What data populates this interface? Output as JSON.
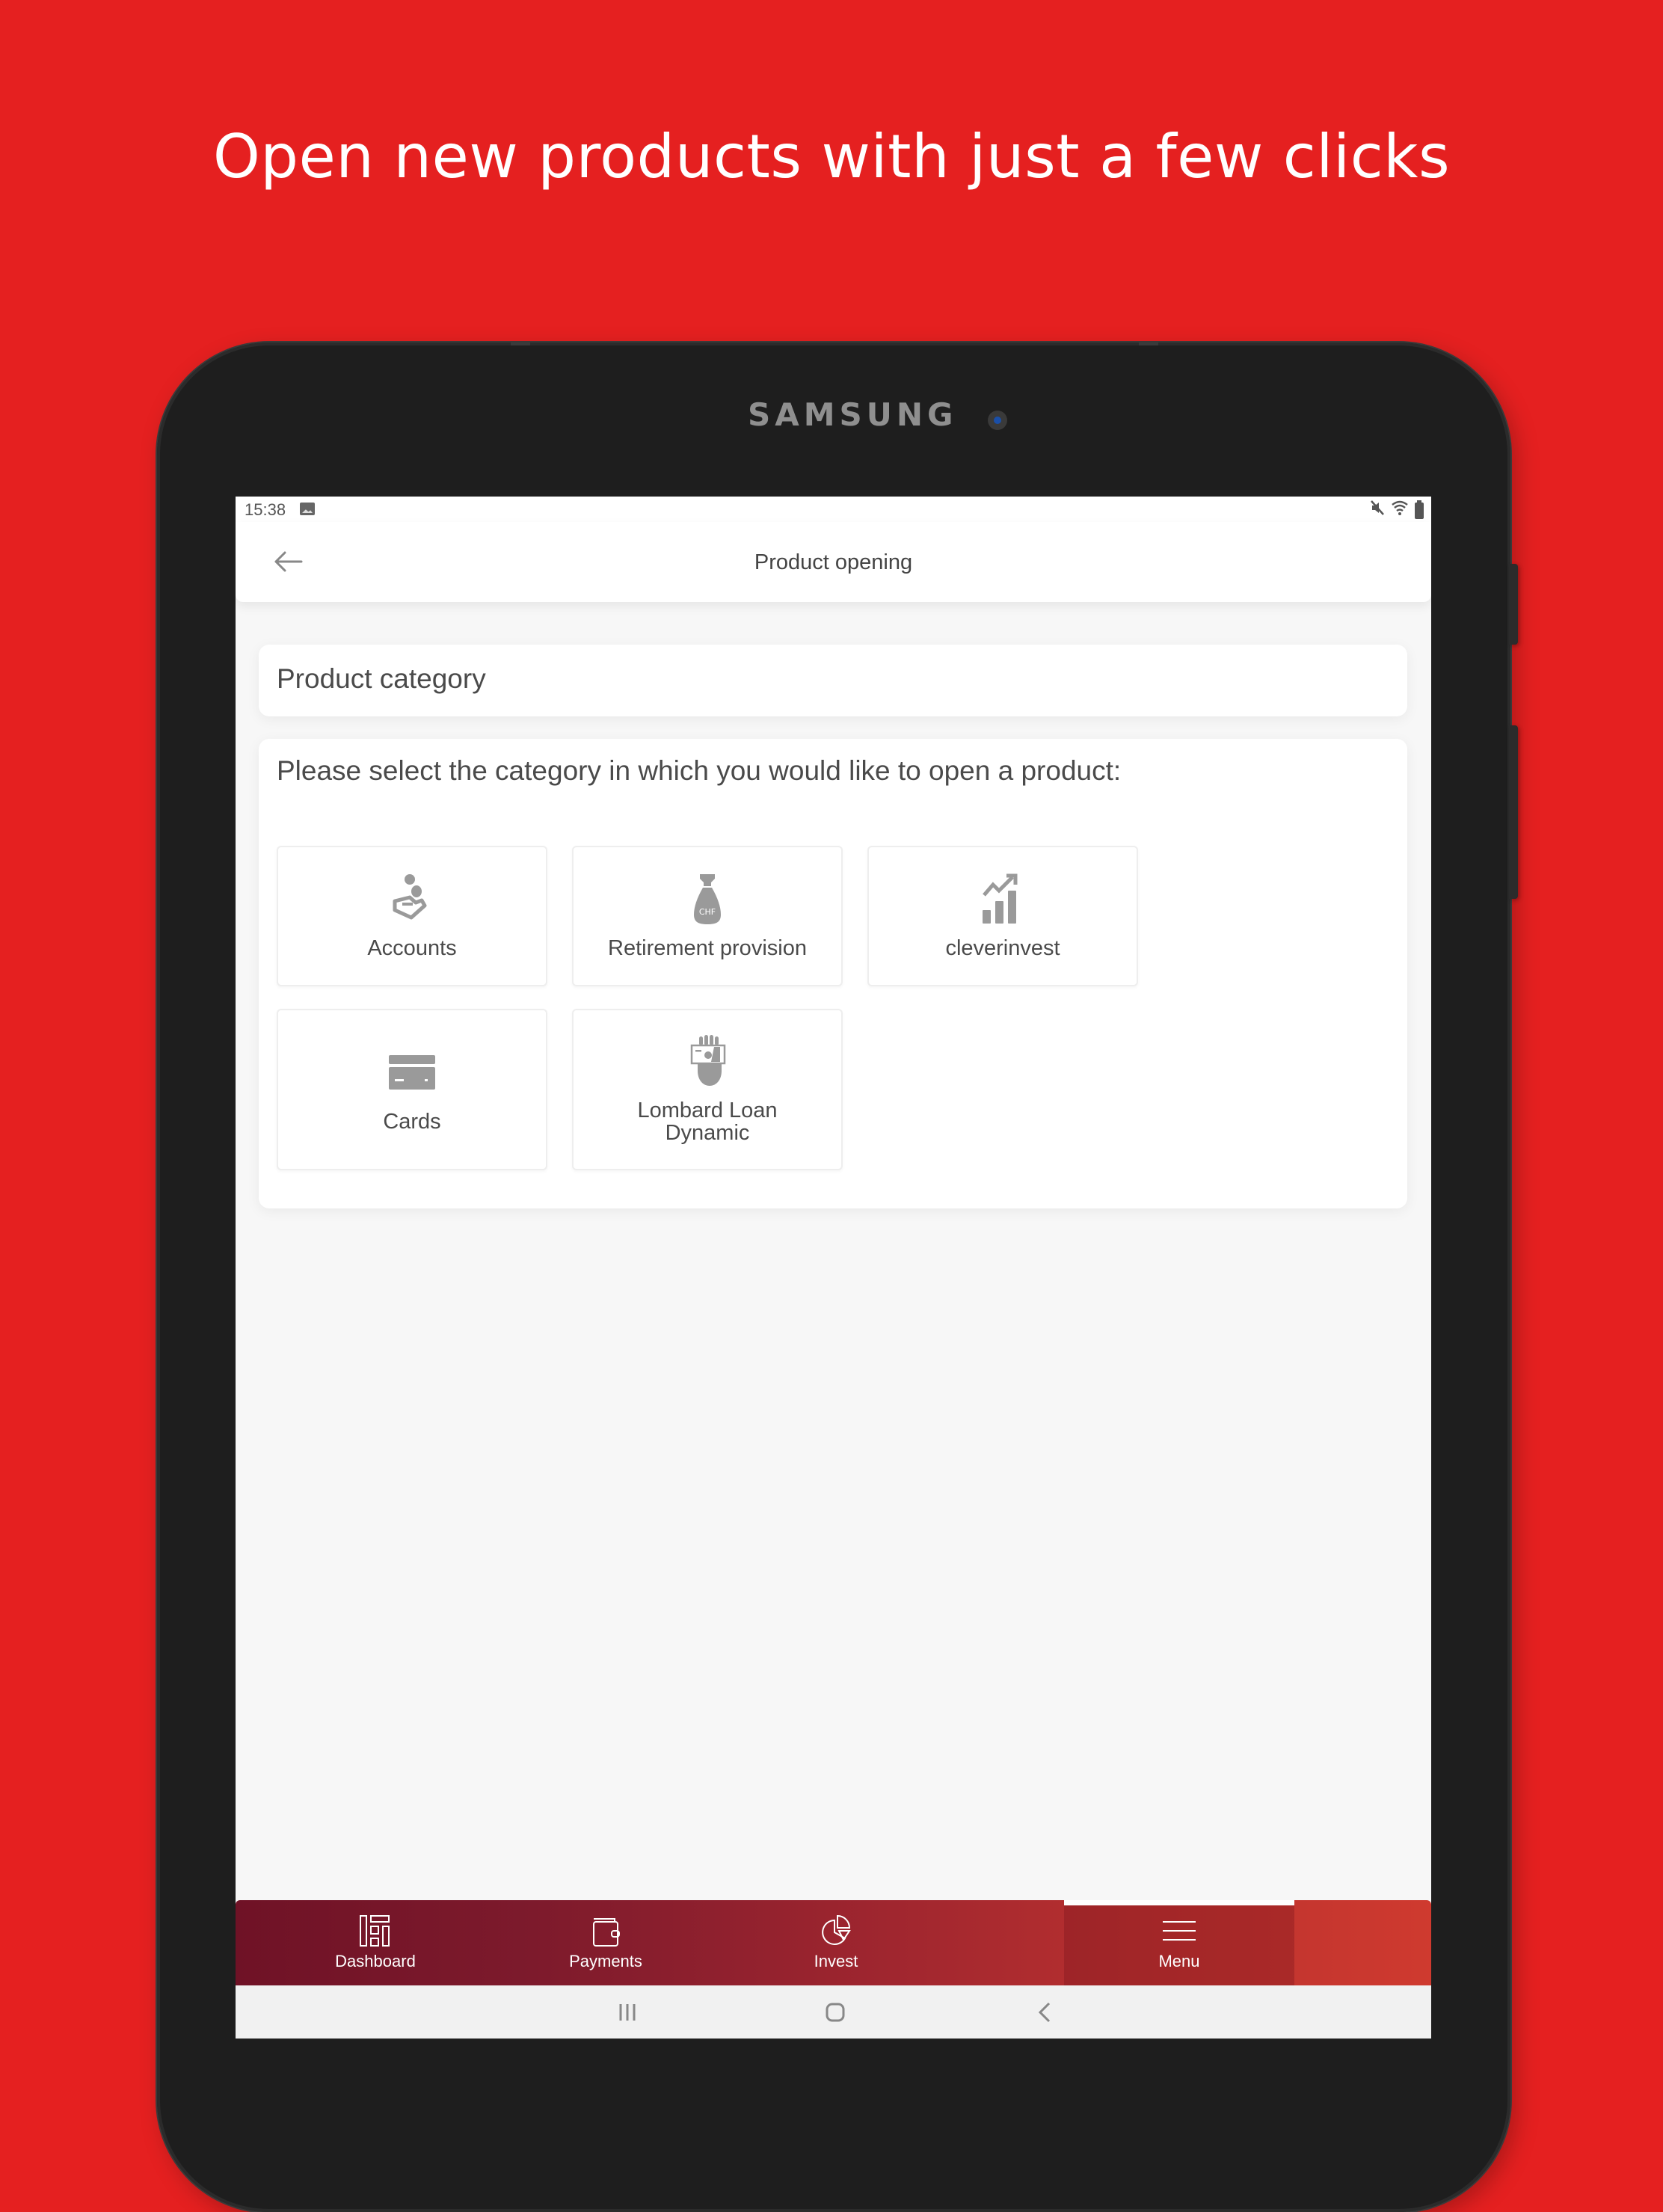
{
  "headline": "Open new products with just a few clicks",
  "device": {
    "brand": "SAMSUNG"
  },
  "status_bar": {
    "time": "15:38",
    "left_icons": [
      "image-notification-icon"
    ],
    "right_icons": [
      "mute-icon",
      "wifi-icon",
      "battery-icon"
    ]
  },
  "app_bar": {
    "back_icon": "arrow-left-icon",
    "title": "Product opening"
  },
  "category_card": {
    "title": "Product category"
  },
  "selection_card": {
    "prompt": "Please select the category in which you would like to open a product:",
    "tiles": [
      {
        "label": "Accounts",
        "icon": "hand-coins-icon"
      },
      {
        "label": "Retirement provision",
        "icon": "chf-money-bag-icon",
        "icon_text": "CHF"
      },
      {
        "label": "cleverinvest",
        "icon": "growth-chart-icon"
      },
      {
        "label": "Cards",
        "icon": "credit-card-icon"
      },
      {
        "label": "Lombard Loan Dynamic",
        "label_lines": [
          "Lombard Loan",
          "Dynamic"
        ],
        "icon": "hand-banknote-icon"
      }
    ]
  },
  "bottom_nav": {
    "items": [
      {
        "label": "Dashboard",
        "icon": "dashboard-icon",
        "active": false
      },
      {
        "label": "Payments",
        "icon": "wallet-icon",
        "active": false
      },
      {
        "label": "Invest",
        "icon": "pie-chart-icon",
        "active": false
      },
      {
        "label": "Menu",
        "icon": "hamburger-menu-icon",
        "active": true
      }
    ]
  },
  "system_nav": {
    "buttons": [
      "recent-apps",
      "home",
      "back"
    ]
  },
  "colors": {
    "background_red": "#e52020",
    "tablet_body": "#1e1e1e",
    "nav_gradient_start": "#6f1226",
    "nav_gradient_end": "#cf3a2f",
    "icon_gray": "#9a9a9a",
    "text_gray": "#4a4a4a"
  }
}
